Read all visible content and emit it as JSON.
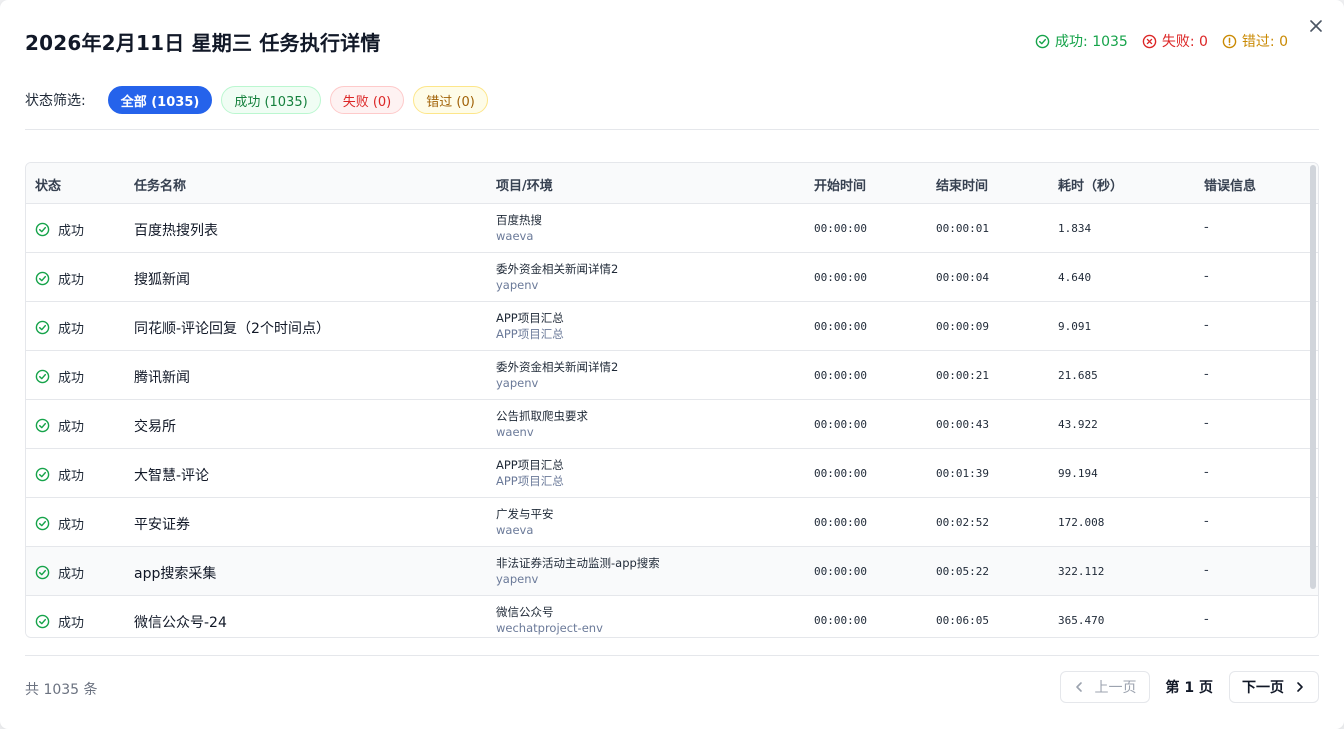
{
  "dialog": {
    "title": "2026年2月11日 星期三 任务执行详情",
    "summary": {
      "success": "成功: 1035",
      "fail": "失败: 0",
      "skip": "错过: 0"
    }
  },
  "colors": {
    "primary": "#2563eb",
    "success": "#16a34a",
    "fail": "#dc2626",
    "skip": "#ca8a04"
  },
  "filter": {
    "label": "状态筛选:",
    "chips": [
      {
        "label": "全部 (1035)",
        "active": true
      },
      {
        "label": "成功 (1035)",
        "active": false
      },
      {
        "label": "失败 (0)",
        "active": false
      },
      {
        "label": "错过 (0)",
        "active": false
      }
    ]
  },
  "table": {
    "headers": {
      "status": "状态",
      "name": "任务名称",
      "project": "项目/环境",
      "start": "开始时间",
      "end": "结束时间",
      "duration": "耗时（秒）",
      "error": "错误信息"
    },
    "rows": [
      {
        "status": "成功",
        "name": "百度热搜列表",
        "project": "百度热搜",
        "env": "waeva",
        "start": "00:00:00",
        "end": "00:00:01",
        "duration": "1.834",
        "error": "-"
      },
      {
        "status": "成功",
        "name": "搜狐新闻",
        "project": "委外资金相关新闻详情2",
        "env": "yapenv",
        "start": "00:00:00",
        "end": "00:00:04",
        "duration": "4.640",
        "error": "-"
      },
      {
        "status": "成功",
        "name": "同花顺-评论回复（2个时间点）",
        "project": "APP项目汇总",
        "env": "APP项目汇总",
        "start": "00:00:00",
        "end": "00:00:09",
        "duration": "9.091",
        "error": "-"
      },
      {
        "status": "成功",
        "name": "腾讯新闻",
        "project": "委外资金相关新闻详情2",
        "env": "yapenv",
        "start": "00:00:00",
        "end": "00:00:21",
        "duration": "21.685",
        "error": "-"
      },
      {
        "status": "成功",
        "name": "交易所",
        "project": "公告抓取爬虫要求",
        "env": "waenv",
        "start": "00:00:00",
        "end": "00:00:43",
        "duration": "43.922",
        "error": "-"
      },
      {
        "status": "成功",
        "name": "大智慧-评论",
        "project": "APP项目汇总",
        "env": "APP项目汇总",
        "start": "00:00:00",
        "end": "00:01:39",
        "duration": "99.194",
        "error": "-"
      },
      {
        "status": "成功",
        "name": "平安证券",
        "project": "广发与平安",
        "env": "waeva",
        "start": "00:00:00",
        "end": "00:02:52",
        "duration": "172.008",
        "error": "-"
      },
      {
        "status": "成功",
        "name": "app搜索采集",
        "project": "非法证券活动主动监测-app搜索",
        "env": "yapenv",
        "start": "00:00:00",
        "end": "00:05:22",
        "duration": "322.112",
        "error": "-"
      },
      {
        "status": "成功",
        "name": "微信公众号-24",
        "project": "微信公众号",
        "env": "wechatproject-env",
        "start": "00:00:00",
        "end": "00:06:05",
        "duration": "365.470",
        "error": "-"
      }
    ]
  },
  "footer": {
    "total": "共 1035 条",
    "prev": "上一页",
    "current": "第 1 页",
    "next": "下一页"
  }
}
